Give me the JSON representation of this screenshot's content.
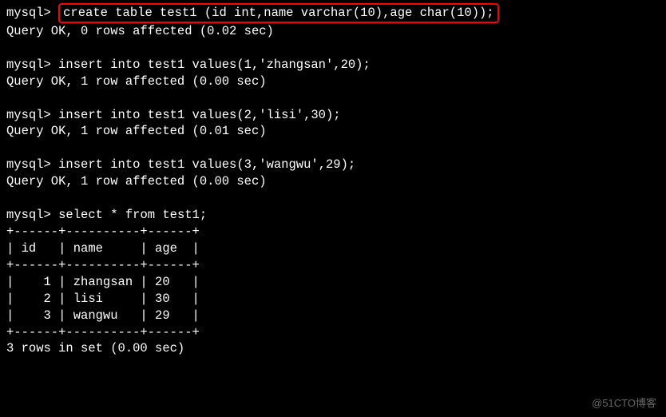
{
  "terminal": {
    "prompt": "mysql>",
    "lines": [
      {
        "type": "cmd",
        "text": "create table test1 (id int,name varchar(10),age char(10));",
        "highlighted": true
      },
      {
        "type": "out",
        "text": "Query OK, 0 rows affected (0.02 sec)"
      },
      {
        "type": "blank",
        "text": ""
      },
      {
        "type": "cmd",
        "text": "insert into test1 values(1,'zhangsan',20);"
      },
      {
        "type": "out",
        "text": "Query OK, 1 row affected (0.00 sec)"
      },
      {
        "type": "blank",
        "text": ""
      },
      {
        "type": "cmd",
        "text": "insert into test1 values(2,'lisi',30);"
      },
      {
        "type": "out",
        "text": "Query OK, 1 row affected (0.01 sec)"
      },
      {
        "type": "blank",
        "text": ""
      },
      {
        "type": "cmd",
        "text": "insert into test1 values(3,'wangwu',29);"
      },
      {
        "type": "out",
        "text": "Query OK, 1 row affected (0.00 sec)"
      },
      {
        "type": "blank",
        "text": ""
      },
      {
        "type": "cmd",
        "text": "select * from test1;"
      },
      {
        "type": "out",
        "text": "+------+----------+------+"
      },
      {
        "type": "out",
        "text": "| id   | name     | age  |"
      },
      {
        "type": "out",
        "text": "+------+----------+------+"
      },
      {
        "type": "out",
        "text": "|    1 | zhangsan | 20   |"
      },
      {
        "type": "out",
        "text": "|    2 | lisi     | 30   |"
      },
      {
        "type": "out",
        "text": "|    3 | wangwu   | 29   |"
      },
      {
        "type": "out",
        "text": "+------+----------+------+"
      },
      {
        "type": "out",
        "text": "3 rows in set (0.00 sec)"
      }
    ]
  },
  "watermark": "@51CTO博客"
}
